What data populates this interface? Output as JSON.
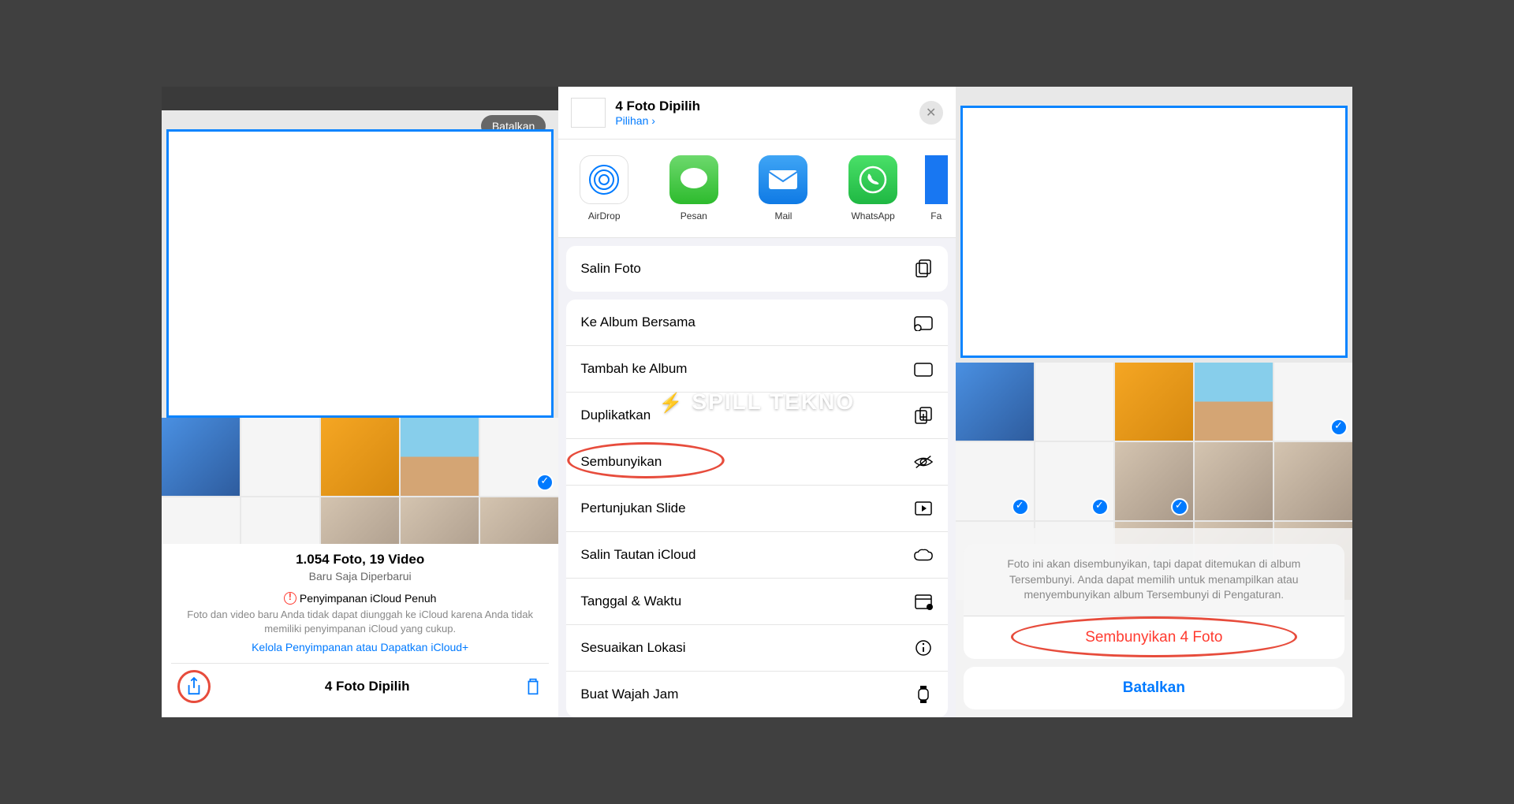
{
  "panel1": {
    "cancel": "Batalkan",
    "photo_count": "1.054 Foto, 19 Video",
    "updated": "Baru Saja Diperbarui",
    "warning_title": "Penyimpanan iCloud Penuh",
    "warning_text": "Foto dan video baru Anda tidak dapat diunggah ke iCloud karena Anda tidak memiliki penyimpanan iCloud yang cukup.",
    "manage_link": "Kelola Penyimpanan atau Dapatkan iCloud+",
    "selected": "4 Foto Dipilih"
  },
  "panel2": {
    "title": "4 Foto Dipilih",
    "options": "Pilihan ›",
    "apps": [
      {
        "name": "AirDrop"
      },
      {
        "name": "Pesan"
      },
      {
        "name": "Mail"
      },
      {
        "name": "WhatsApp"
      },
      {
        "name": "Fa"
      }
    ],
    "actions": {
      "copy": "Salin Foto",
      "shared_album": "Ke Album Bersama",
      "add_album": "Tambah ke Album",
      "duplicate": "Duplikatkan",
      "hide": "Sembunyikan",
      "slideshow": "Pertunjukan Slide",
      "copy_link": "Salin Tautan iCloud",
      "date_time": "Tanggal & Waktu",
      "location": "Sesuaikan Lokasi",
      "watch_face": "Buat Wajah Jam"
    }
  },
  "panel3": {
    "modal_text": "Foto ini akan disembunyikan, tapi dapat ditemukan di album Tersembunyi. Anda dapat memilih untuk menampilkan atau menyembunyikan album Tersembunyi di Pengaturan.",
    "hide_action": "Sembunyikan 4 Foto",
    "cancel": "Batalkan"
  },
  "watermark": "SPILL TEKNO"
}
